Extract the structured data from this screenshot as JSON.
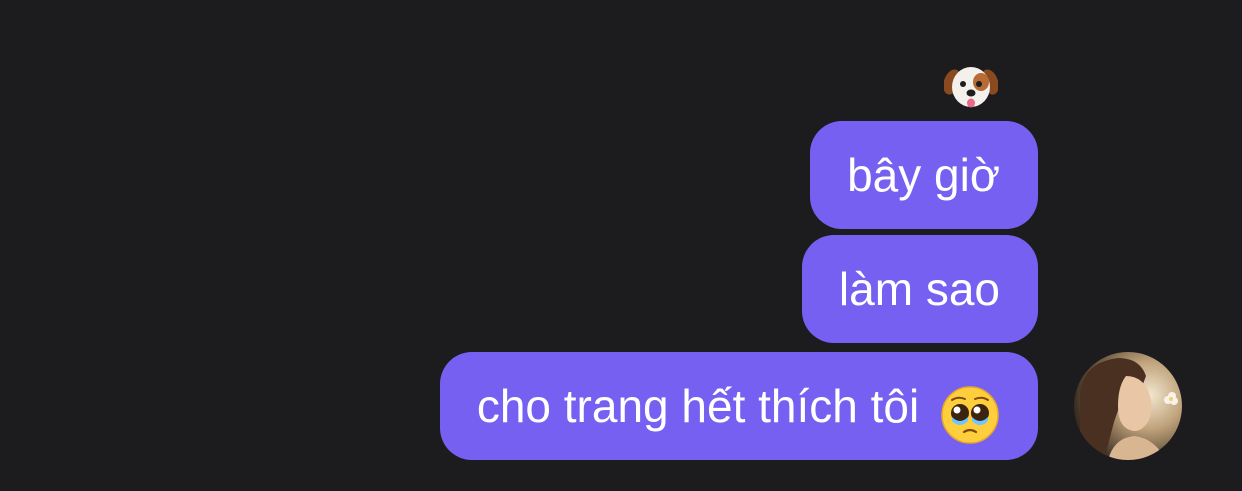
{
  "reaction": {
    "icon": "dog-face-icon"
  },
  "messages": [
    {
      "text": "bây giờ"
    },
    {
      "text": "làm sao"
    },
    {
      "text": "cho trang hết thích tôi",
      "emoji": "pleading-face-icon"
    }
  ],
  "avatar": {
    "icon": "user-avatar-photo"
  },
  "colors": {
    "background": "#1c1c1e",
    "bubble": "#7660f2",
    "bubble_text": "#ffffff"
  }
}
